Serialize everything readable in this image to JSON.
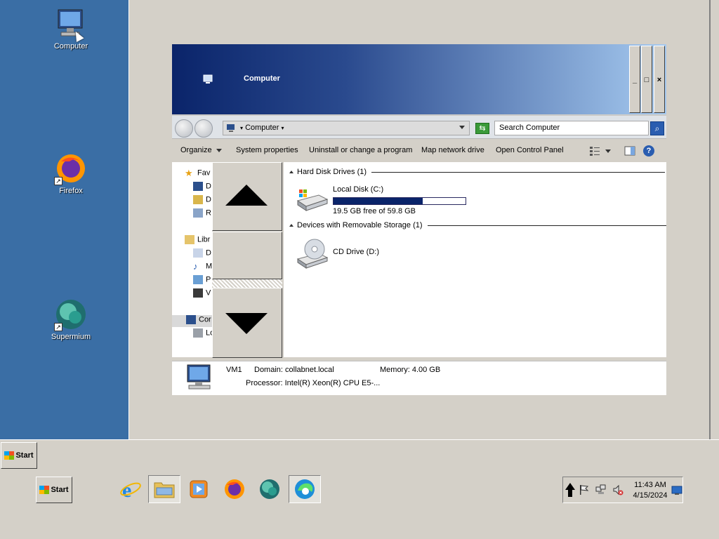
{
  "desktop": {
    "icons": [
      {
        "label": "Computer",
        "icon": "computer-icon"
      },
      {
        "label": "Firefox",
        "icon": "firefox-icon"
      },
      {
        "label": "Supermium",
        "icon": "supermium-icon"
      }
    ]
  },
  "window": {
    "title": "Computer",
    "controls": {
      "minimize": "_",
      "maximize": "□",
      "close": "×"
    },
    "address": {
      "crumb": "Computer"
    },
    "search": {
      "placeholder": "Search Computer"
    },
    "toolbar": {
      "organize": "Organize",
      "system_properties": "System properties",
      "uninstall": "Uninstall or change a program",
      "map_drive": "Map network drive",
      "control_panel": "Open Control Panel",
      "help": "?"
    },
    "nav_pane": {
      "items": [
        "Fav",
        "D",
        "D",
        "R",
        "Libr",
        "D",
        "M",
        "P",
        "V",
        "Cor",
        "Lo"
      ]
    },
    "content": {
      "groups": [
        {
          "label": "Hard Disk Drives (1)"
        },
        {
          "label": "Devices with Removable Storage (1)"
        }
      ],
      "local_disk": {
        "name": "Local Disk (C:)",
        "free_text": "19.5 GB free of 59.8 GB",
        "used_fraction": 0.674
      },
      "cd_drive": {
        "name": "CD Drive (D:)"
      }
    },
    "details": {
      "name": "VM1",
      "domain": "Domain: collabnet.local",
      "memory": "Memory: 4.00 GB",
      "processor": "Processor: Intel(R) Xeon(R) CPU E5-..."
    }
  },
  "taskbar": {
    "start_top": "Start",
    "start": "Start",
    "clock_time": "11:43 AM",
    "clock_date": "4/15/2024"
  },
  "colors": {
    "desktop": "#3a6ea5",
    "title_gradient_start": "#0a246a",
    "title_gradient_end": "#a6caf0",
    "progress": "#0a246a"
  }
}
